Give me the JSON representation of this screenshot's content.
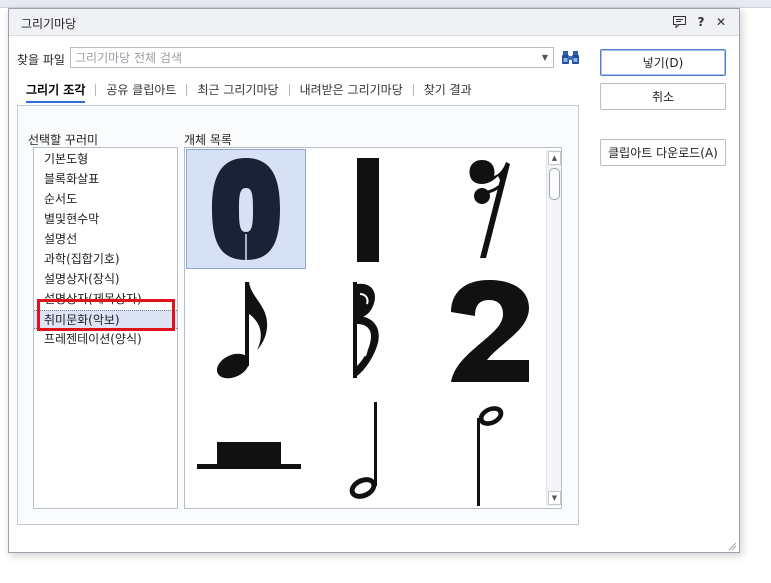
{
  "window": {
    "title": "그리기마당"
  },
  "titlebar_icons": [
    "comment-icon",
    "help-icon",
    "close-icon"
  ],
  "titlebar_glyphs": {
    "help": "?",
    "close": "✕"
  },
  "search": {
    "label": "찾을 파일",
    "placeholder": "그리기마당 전체 검색",
    "value": ""
  },
  "tabs": [
    {
      "label": "그리기 조각",
      "active": true
    },
    {
      "label": "공유 클립아트",
      "active": false
    },
    {
      "label": "최근 그리기마당",
      "active": false
    },
    {
      "label": "내려받은 그리기마당",
      "active": false
    },
    {
      "label": "찾기 결과",
      "active": false
    }
  ],
  "decoration": {
    "label": "선택할 꾸러미",
    "items": [
      "기본도형",
      "블록화살표",
      "순서도",
      "별및현수막",
      "설명선",
      "과학(집합기호)",
      "설명상자(장식)",
      "설명상자(제목상자)",
      "취미문화(악보)",
      "프레젠테이션(양식)"
    ],
    "selected_index": 8
  },
  "objects": {
    "label": "개체 목록",
    "icons": [
      "digit-zero-icon",
      "bar-line-icon",
      "eighth-rest-icon",
      "eighth-note-icon",
      "sharp-flag-icon",
      "digit-two-icon",
      "whole-rest-icon",
      "half-note-down-icon",
      "half-note-up-icon"
    ],
    "selected_index": 0
  },
  "buttons": {
    "insert": "넣기(D)",
    "cancel": "취소",
    "clipart_download": "클립아트 다운로드(A)"
  },
  "colors": {
    "accent": "#2d6fd6",
    "selection": "#d7e1f5",
    "highlight": "#e0131c",
    "glyph": "#111111",
    "zero_fill": "#1b2236"
  }
}
